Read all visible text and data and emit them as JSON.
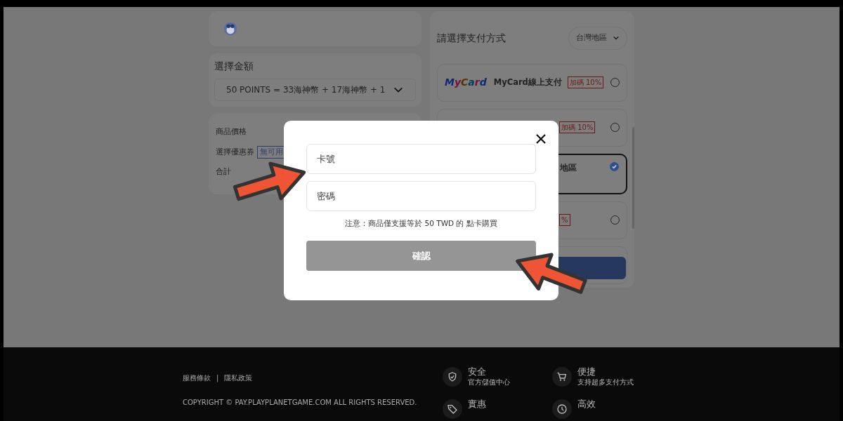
{
  "header": {
    "kind": "logo"
  },
  "amount": {
    "label": "選擇金額",
    "value": "50 POINTS = 33海神幣 + 17海神幣 + 1"
  },
  "summary": {
    "rows": [
      {
        "label": "商品價格"
      },
      {
        "label": "選擇優惠券",
        "coupon": "無可用"
      },
      {
        "label": "合計"
      }
    ]
  },
  "payment": {
    "title": "請選擇支付方式",
    "region": "台灣地區",
    "methods": [
      {
        "kind": "logo",
        "logo": "MyCard",
        "name": "MyCard線上支付",
        "badge": "加碼 10%",
        "selected": false
      },
      {
        "kind": "covered",
        "badge": "加碼 10%",
        "selected": false
      },
      {
        "kind": "covered",
        "name": "地區",
        "selected": true
      },
      {
        "kind": "covered",
        "badge": "%",
        "selected": false
      },
      {
        "kind": "partial",
        "selected": false
      }
    ]
  },
  "modal": {
    "fields": [
      {
        "placeholder": "卡號"
      },
      {
        "placeholder": "密碼"
      }
    ],
    "note": "注意：商品僅支援等於 50 TWD 的 點卡購買",
    "confirm": "確認",
    "disabled": true
  },
  "footer": {
    "links": [
      "服務條款",
      "隱私政策"
    ],
    "separator": "|",
    "copyright": "COPYRIGHT © PAY.PLAYPLANETGAME.COM ALL RIGHTS RESERVED.",
    "features": [
      {
        "kind": "shield",
        "title": "安全",
        "subtitle": "官方儲值中心"
      },
      {
        "kind": "cart",
        "title": "便捷",
        "subtitle": "支持超多支付方式"
      },
      {
        "kind": "tag",
        "title": "實惠"
      },
      {
        "kind": "clock",
        "title": "高效"
      }
    ]
  }
}
